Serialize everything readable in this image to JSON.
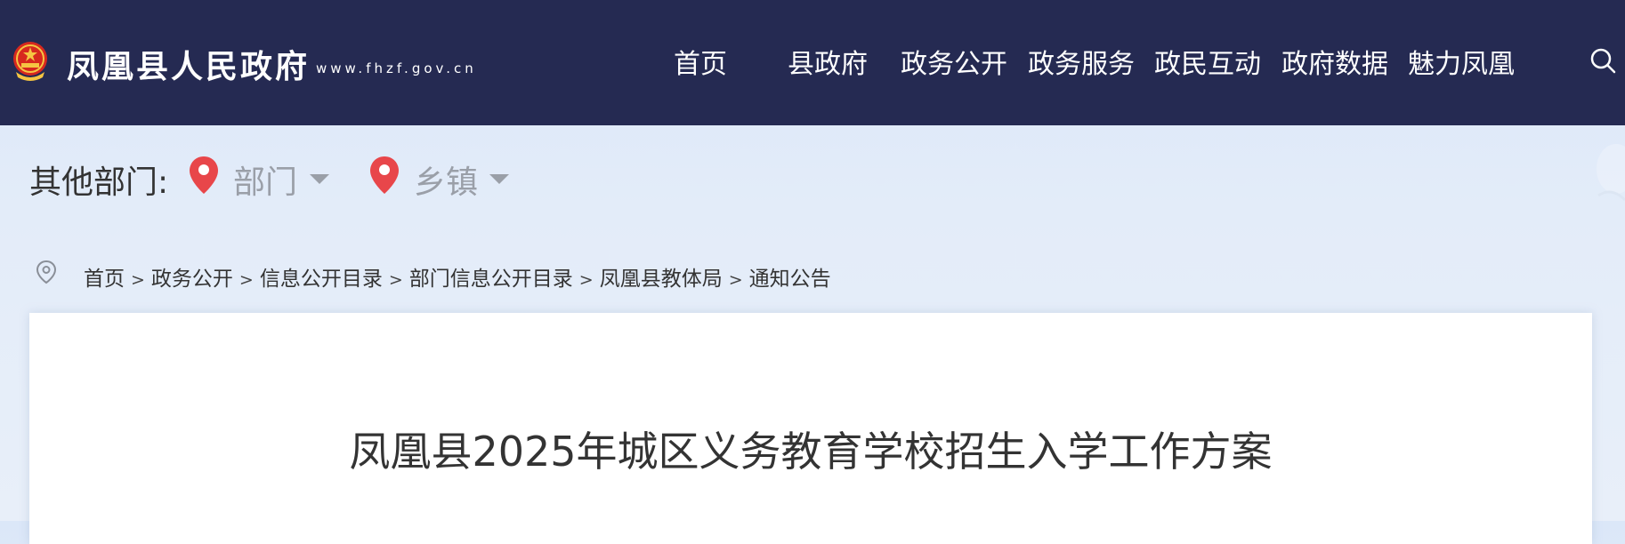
{
  "header": {
    "site_name": "凤凰县人民政府",
    "site_url": "www.fhzf.gov.cn",
    "nav": [
      "首页",
      "县政府",
      "政务公开",
      "政务服务",
      "政民互动",
      "政府数据",
      "魅力凤凰"
    ],
    "search_icon": "search-icon",
    "brand_color": "#252a52"
  },
  "filters": {
    "label": "其他部门:",
    "department": "部门",
    "township": "乡镇",
    "pin_color": "#e8464a"
  },
  "breadcrumb": [
    "首页",
    "政务公开",
    "信息公开目录",
    "部门信息公开目录",
    "凤凰县教体局",
    "通知公告"
  ],
  "breadcrumb_separator": ">",
  "article": {
    "title": "凤凰县2025年城区义务教育学校招生入学工作方案"
  }
}
